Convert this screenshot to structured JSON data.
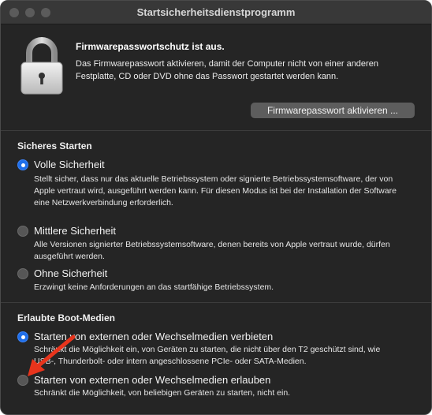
{
  "window": {
    "title": "Startsicherheitsdienstprogramm"
  },
  "firmware": {
    "title": "Firmwarepasswortschutz ist aus.",
    "description": "Das Firmwarepasswort aktivieren, damit der Computer nicht von einer anderen Festplatte, CD oder DVD ohne das Passwort gestartet werden kann.",
    "button_label": "Firmwarepasswort aktivieren ...",
    "icon": "lock-icon"
  },
  "secure_boot": {
    "title": "Sicheres Starten",
    "options": [
      {
        "label": "Volle Sicherheit",
        "description": "Stellt sicher, dass nur das aktuelle Betriebssystem oder signierte Betriebssystemsoftware, der von Apple vertraut wird, ausgeführt werden kann. Für diesen Modus ist bei der Installation der Software eine Netzwerkverbindung erforderlich.",
        "selected": true
      },
      {
        "label": "Mittlere Sicherheit",
        "description": "Alle Versionen signierter Betriebssystemsoftware, denen bereits von Apple vertraut wurde, dürfen ausgeführt werden.",
        "selected": false
      },
      {
        "label": "Ohne Sicherheit",
        "description": "Erzwingt keine Anforderungen an das startfähige Betriebssystem.",
        "selected": false
      }
    ]
  },
  "boot_media": {
    "title": "Erlaubte Boot-Medien",
    "options": [
      {
        "label": "Starten von externen oder Wechselmedien verbieten",
        "description": "Schränkt die Möglichkeit ein, von Geräten zu starten, die nicht über den T2 geschützt sind, wie USB-, Thunderbolt- oder intern angeschlossene PCIe- oder SATA-Medien.",
        "selected": true
      },
      {
        "label": "Starten von externen oder Wechselmedien erlauben",
        "description": "Schränkt die Möglichkeit, von beliebigen Geräten zu starten, nicht ein.",
        "selected": false
      }
    ]
  },
  "colors": {
    "window_bg": "#252525",
    "accent": "#1f6feb",
    "annotation_arrow": "#e8341c"
  }
}
